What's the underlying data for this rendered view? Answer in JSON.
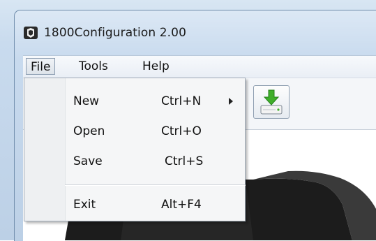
{
  "window": {
    "title": "1800Configuration 2.00",
    "icon": "app-logo-icon"
  },
  "menubar": {
    "items": [
      {
        "label": "File",
        "active": true
      },
      {
        "label": "Tools"
      },
      {
        "label": "Help"
      }
    ]
  },
  "file_menu": {
    "items": [
      {
        "label": "New",
        "shortcut": "Ctrl+N",
        "submenu": true
      },
      {
        "label": "Open",
        "shortcut": "Ctrl+O"
      },
      {
        "label": "Save",
        "shortcut": "Ctrl+S"
      },
      {
        "label": "Exit",
        "shortcut": "Alt+F4"
      }
    ]
  },
  "toolbar": {
    "buttons": [
      {
        "icon": "download-to-device-icon"
      }
    ]
  },
  "colors": {
    "accent_green": "#3fae2a",
    "frame_blue": "#c9dbee",
    "menu_background": "#f5f6f7"
  }
}
